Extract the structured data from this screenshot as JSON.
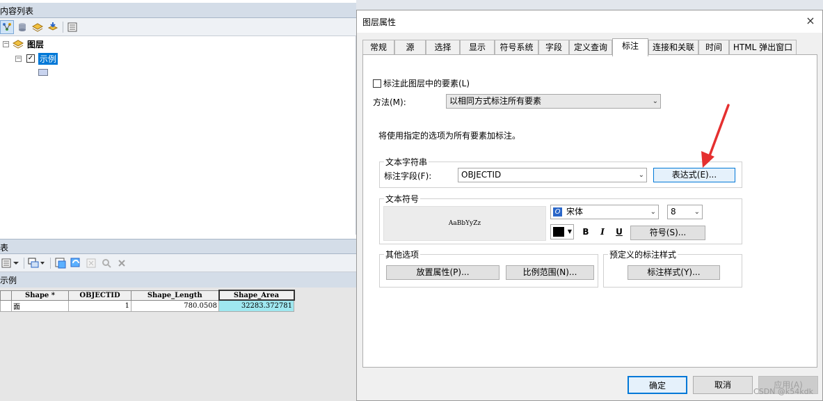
{
  "toc": {
    "title": "内容列表",
    "tree": {
      "layers_label": "图层",
      "layer_name": "示例"
    }
  },
  "table": {
    "title": "表",
    "tab_label": "示例",
    "columns": [
      "Shape *",
      "OBJECTID",
      "Shape_Length",
      "Shape_Area"
    ],
    "row": {
      "shape": "面",
      "objectid": "1",
      "length": "780.0508",
      "area": "32283.372781"
    }
  },
  "dialog": {
    "title": "图层属性",
    "close_icon": "×",
    "tabs": [
      "常规",
      "源",
      "选择",
      "显示",
      "符号系统",
      "字段",
      "定义查询",
      "标注",
      "连接和关联",
      "时间",
      "HTML 弹出窗口"
    ],
    "active_tab": "标注",
    "label_features_checkbox": "标注此图层中的要素(L)",
    "method_label": "方法(M):",
    "method_value": "以相同方式标注所有要素",
    "info_text": "将使用指定的选项为所有要素加标注。",
    "text_string": {
      "group_title": "文本字符串",
      "field_label": "标注字段(F):",
      "field_value": "OBJECTID",
      "expression_button": "表达式(E)..."
    },
    "text_symbol": {
      "group_title": "文本符号",
      "preview_text": "AaBbYyZz",
      "font_name": "宋体",
      "font_size": "8",
      "bold": "B",
      "italic": "I",
      "underline": "U",
      "symbol_button": "符号(S)...",
      "color": "#000000"
    },
    "other_options": {
      "group_title": "其他选项",
      "placement_button": "放置属性(P)...",
      "scale_button": "比例范围(N)..."
    },
    "predefined": {
      "group_title": "预定义的标注样式",
      "style_button": "标注样式(Y)..."
    },
    "footer": {
      "ok": "确定",
      "cancel": "取消",
      "apply": "应用(A)"
    }
  },
  "watermark": "CSDN @k54kdk",
  "colors": {
    "accent": "#0078d7",
    "arrow": "#e53030",
    "highlight_cell": "#9fe7ef"
  }
}
